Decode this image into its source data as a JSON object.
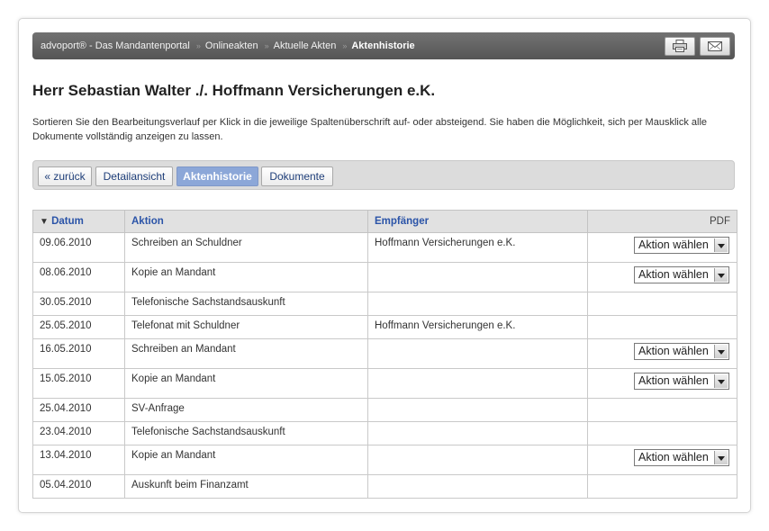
{
  "breadcrumb": {
    "items": [
      "advoport® - Das Mandantenportal",
      "Onlineakten",
      "Aktuelle Akten",
      "Aktenhistorie"
    ],
    "separator": "»"
  },
  "toolbar": {
    "print_icon": "printer-icon",
    "mail_icon": "envelope-icon"
  },
  "page": {
    "title": "Herr Sebastian Walter ./. Hoffmann Versicherungen e.K.",
    "intro": "Sortieren Sie den Bearbeitungsverlauf per Klick in die jeweilige Spaltenüberschrift auf- oder absteigend. Sie haben die Möglichkeit, sich per Mausklick alle Dokumente vollständig anzeigen zu lassen."
  },
  "tabs": {
    "back": "« zurück",
    "detail": "Detailansicht",
    "history": "Aktenhistorie",
    "documents": "Dokumente",
    "active": "history"
  },
  "table": {
    "sort_arrow": "▼",
    "headers": {
      "datum": "Datum",
      "aktion": "Aktion",
      "empfaenger": "Empfänger",
      "pdf": "PDF"
    },
    "select_label": "Aktion wählen",
    "rows": [
      {
        "datum": "09.06.2010",
        "aktion": "Schreiben an Schuldner",
        "empfaenger": "Hoffmann Versicherungen e.K.",
        "has_pdf": true
      },
      {
        "datum": "08.06.2010",
        "aktion": "Kopie an Mandant",
        "empfaenger": "",
        "has_pdf": true
      },
      {
        "datum": "30.05.2010",
        "aktion": "Telefonische Sachstandsauskunft",
        "empfaenger": "",
        "has_pdf": false
      },
      {
        "datum": "25.05.2010",
        "aktion": "Telefonat mit Schuldner",
        "empfaenger": "Hoffmann Versicherungen e.K.",
        "has_pdf": false
      },
      {
        "datum": "16.05.2010",
        "aktion": "Schreiben an Mandant",
        "empfaenger": "",
        "has_pdf": true
      },
      {
        "datum": "15.05.2010",
        "aktion": "Kopie an Mandant",
        "empfaenger": "",
        "has_pdf": true
      },
      {
        "datum": "25.04.2010",
        "aktion": "SV-Anfrage",
        "empfaenger": "",
        "has_pdf": false
      },
      {
        "datum": "23.04.2010",
        "aktion": "Telefonische Sachstandsauskunft",
        "empfaenger": "",
        "has_pdf": false
      },
      {
        "datum": "13.04.2010",
        "aktion": "Kopie an Mandant",
        "empfaenger": "",
        "has_pdf": true
      },
      {
        "datum": "05.04.2010",
        "aktion": "Auskunft beim Finanzamt",
        "empfaenger": "",
        "has_pdf": false
      }
    ]
  }
}
